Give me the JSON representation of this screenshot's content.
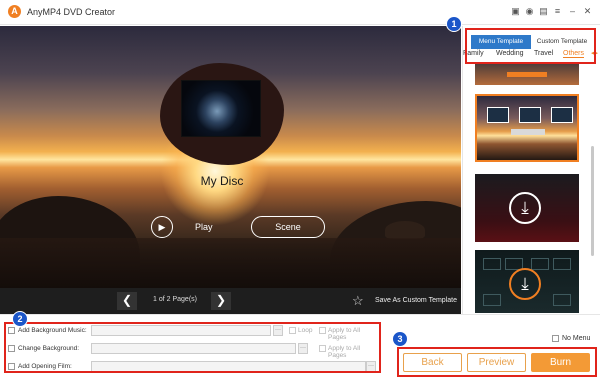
{
  "app": {
    "title": "AnyMP4 DVD Creator",
    "logo": "A"
  },
  "window_buttons": [
    "save-icon",
    "user-icon",
    "feedback-icon",
    "menu-icon",
    "minimize-icon",
    "close-icon"
  ],
  "window_glyphs": {
    "save": "▣",
    "user": "◉",
    "feedback": "▤",
    "menu": "≡",
    "minimize": "–",
    "close": "✕"
  },
  "preview": {
    "disc_title": "My Disc",
    "play_label": "Play",
    "scene_label": "Scene",
    "play_glyph": "▶",
    "prev_glyph": "❮",
    "next_glyph": "❯",
    "page_info": "1 of 2 Page(s)",
    "save_template_glyph": "☆",
    "save_template_label": "Save As Custom Template"
  },
  "template_panel": {
    "tabs": [
      {
        "label": "Menu Template",
        "active": true
      },
      {
        "label": "Custom Template",
        "active": false
      }
    ],
    "categories": [
      "Family",
      "Wedding",
      "Travel",
      "Others"
    ],
    "active_category": "Others",
    "more_glyph": "◂▸",
    "download_glyph": "⤓"
  },
  "options": {
    "music_label": "Add Background Music:",
    "loop_label": "Loop",
    "apply_label": "Apply to All Pages",
    "background_label": "Change Background:",
    "film_label": "Add Opening Film:",
    "browse_label": "···"
  },
  "actions": {
    "no_menu_label": "No Menu",
    "back_label": "Back",
    "preview_label": "Preview",
    "burn_label": "Burn"
  },
  "badges": [
    "1",
    "2",
    "3"
  ],
  "colors": {
    "accent": "#f39a36",
    "tab_active": "#2e79c9",
    "highlight": "#e0241b",
    "badge": "#1b56c9"
  }
}
